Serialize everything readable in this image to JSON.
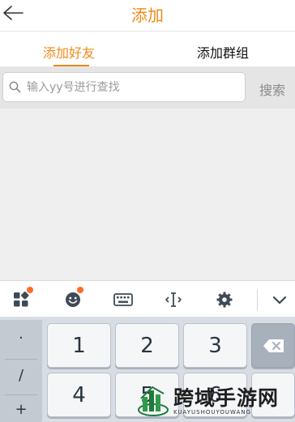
{
  "header": {
    "title": "添加",
    "back_icon": "back-arrow-icon"
  },
  "tabs": [
    {
      "label": "添加好友",
      "active": true
    },
    {
      "label": "添加群组",
      "active": false
    }
  ],
  "search": {
    "placeholder": "输入yy号进行查找",
    "value": "",
    "button_label": "搜索"
  },
  "keyboard_toolbar": {
    "icons": [
      "apps-grid-icon",
      "emoji-icon",
      "keyboard-icon",
      "text-cursor-icon",
      "gear-icon",
      "chevron-down-icon"
    ]
  },
  "keyboard": {
    "symbols": [
      "·",
      "/",
      "+"
    ],
    "keys": [
      "1",
      "2",
      "3",
      "4",
      "5",
      "6"
    ],
    "delete_icon": "backspace-icon"
  },
  "watermark": {
    "text": "跨域手游网",
    "subtext": "KUAYUSHOUYOUWANG"
  },
  "colors": {
    "accent": "#f08a16",
    "notification_dot": "#ff6a2b"
  }
}
